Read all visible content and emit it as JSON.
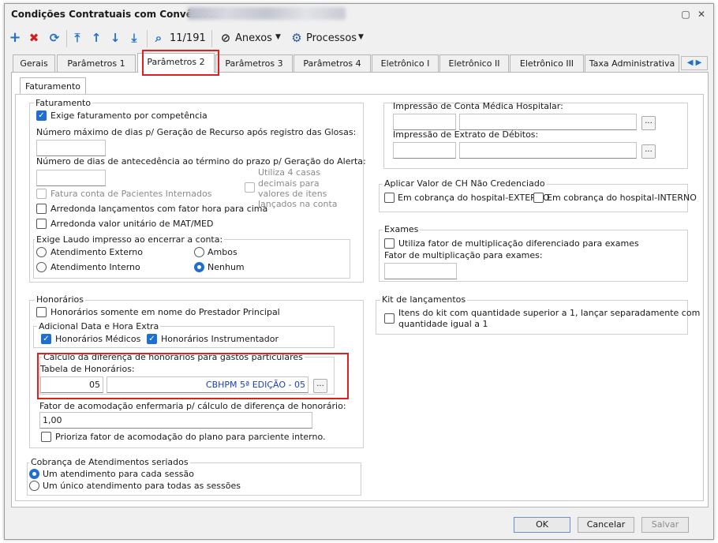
{
  "window": {
    "title": "Condições Contratuais com Convênios:"
  },
  "toolbar": {
    "record_counter": "11/191",
    "attachments_label": "Anexos",
    "processes_label": "Processos"
  },
  "tabs": [
    "Gerais",
    "Parâmetros 1",
    "Parâmetros 2",
    "Parâmetros 3",
    "Parâmetros 4",
    "Eletrônico I",
    "Eletrônico II",
    "Eletrônico III",
    "Taxa Administrativa"
  ],
  "subtab": "Faturamento",
  "faturamento": {
    "group_label": "Faturamento",
    "competencia": "Exige faturamento por competência",
    "max_dias_label": "Número máximo de dias p/ Geração de Recurso após registro das Glosas:",
    "dias_antecedencia_label": "Número de dias de antecedência ao término do prazo p/ Geração do Alerta:",
    "fatura_internados": "Fatura conta de Pacientes Internados",
    "arredonda_fator": "Arredonda lançamentos com fator hora para cima",
    "arredonda_valor": "Arredonda valor unitário de MAT/MED",
    "quatro_casas_l1": "Utiliza 4 casas",
    "quatro_casas_l2": "decimais para",
    "quatro_casas_l3": "valores de itens",
    "quatro_casas_l4": "lançados na conta",
    "laudo_label": "Exige Laudo impresso ao encerrar a conta:",
    "laudo_opt1": "Atendimento Externo",
    "laudo_opt2": "Ambos",
    "laudo_opt3": "Atendimento Interno",
    "laudo_opt4": "Nenhum"
  },
  "impressao": {
    "conta_label": "Impressão de Conta Médica Hospitalar:",
    "extrato_label": "Impressão de Extrato de Débitos:",
    "btn": "..."
  },
  "valor_ch": {
    "label": "Aplicar Valor de CH Não Credenciado",
    "externo": "Em cobrança do hospital-EXTERNO",
    "interno": "Em cobrança do hospital-INTERNO"
  },
  "exames": {
    "label": "Exames",
    "fator_diferenciado": "Utiliza fator de multiplicação diferenciado para exames",
    "fator_label": "Fator de multiplicação para exames:"
  },
  "kit": {
    "label": "Kit de lançamentos",
    "line1": "Itens do kit com quantidade superior a 1, lançar separadamente com",
    "line2": "quantidade igual a 1"
  },
  "honorarios": {
    "label": "Honorários",
    "prestador": "Honorários somente em nome do Prestador Principal",
    "adicional_label": "Adicional Data e Hora Extra",
    "medicos": "Honorários Médicos",
    "instrumentador": "Honorários Instrumentador",
    "calculo_label": "Cálculo da diferença de honorários para gastos particulares",
    "tabela_label": "Tabela de Honorários:",
    "tabela_code": "05",
    "tabela_desc": "CBHPM 5ª EDIÇÃO - 05",
    "btn": "...",
    "fator_label": "Fator de acomodação enfermaria p/ cálculo de diferença de honorário:",
    "fator_value": "1,00",
    "prioriza": "Prioriza fator de acomodação do plano para parciente interno."
  },
  "seriados": {
    "label": "Cobrança de Atendimentos seriados",
    "opt1": "Um atendimento para cada sessão",
    "opt2": "Um único atendimento para todas as sessões"
  },
  "buttons": {
    "ok": "OK",
    "cancel": "Cancelar",
    "save": "Salvar"
  },
  "colors": {
    "accent": "#1f6fd0",
    "highlight": "#e02020",
    "link_text": "#1a3fb8"
  }
}
